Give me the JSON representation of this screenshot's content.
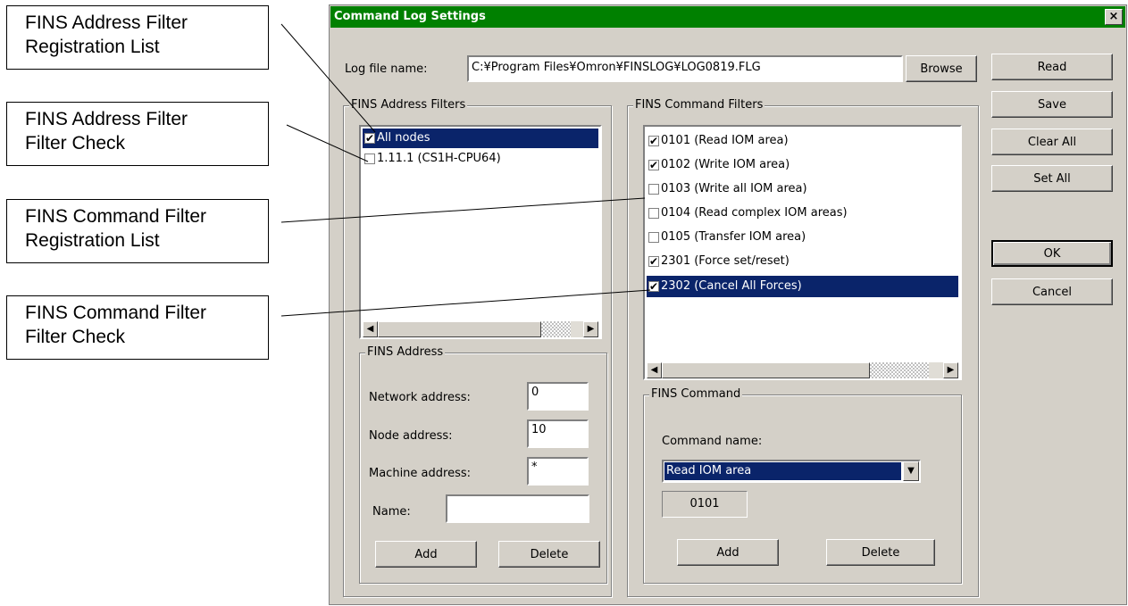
{
  "callouts": [
    {
      "lines": [
        "FINS Address Filter",
        "Registration List"
      ]
    },
    {
      "lines": [
        "FINS Address Filter",
        "Filter Check"
      ]
    },
    {
      "lines": [
        "FINS Command Filter",
        "Registration List"
      ]
    },
    {
      "lines": [
        "FINS Command Filter",
        "Filter Check"
      ]
    }
  ],
  "dialog": {
    "title": "Command Log Settings",
    "close_label": "×",
    "log_file_label": "Log file name:",
    "log_file_value": "C:¥Program Files¥Omron¥FINSLOG¥LOG0819.FLG",
    "browse_label": "Browse",
    "side_buttons": {
      "read": "Read",
      "save": "Save",
      "clear_all": "Clear All",
      "set_all": "Set All",
      "ok": "OK",
      "cancel": "Cancel"
    },
    "address_filters": {
      "title": "FINS Address Filters",
      "items": [
        {
          "label": "All nodes",
          "checked": true,
          "selected": true
        },
        {
          "label": "1.11.1 (CS1H-CPU64)",
          "checked": false,
          "selected": false
        }
      ]
    },
    "fins_address": {
      "title": "FINS Address",
      "network_label": "Network address:",
      "network_value": "0",
      "node_label": "Node address:",
      "node_value": "10",
      "machine_label": "Machine address:",
      "machine_value": "*",
      "name_label": "Name:",
      "name_value": "",
      "add_label": "Add",
      "delete_label": "Delete"
    },
    "command_filters": {
      "title": "FINS Command Filters",
      "items": [
        {
          "label": "0101 (Read IOM area)",
          "checked": true,
          "selected": false
        },
        {
          "label": "0102 (Write IOM area)",
          "checked": true,
          "selected": false
        },
        {
          "label": "0103 (Write all IOM area)",
          "checked": false,
          "selected": false
        },
        {
          "label": "0104 (Read complex IOM areas)",
          "checked": false,
          "selected": false
        },
        {
          "label": "0105 (Transfer IOM area)",
          "checked": false,
          "selected": false
        },
        {
          "label": "2301 (Force set/reset)",
          "checked": true,
          "selected": false
        },
        {
          "label": "2302 (Cancel All Forces)",
          "checked": true,
          "selected": true
        }
      ]
    },
    "fins_command": {
      "title": "FINS Command",
      "command_name_label": "Command name:",
      "command_name_value": "Read IOM area",
      "command_code": "0101",
      "add_label": "Add",
      "delete_label": "Delete"
    }
  }
}
